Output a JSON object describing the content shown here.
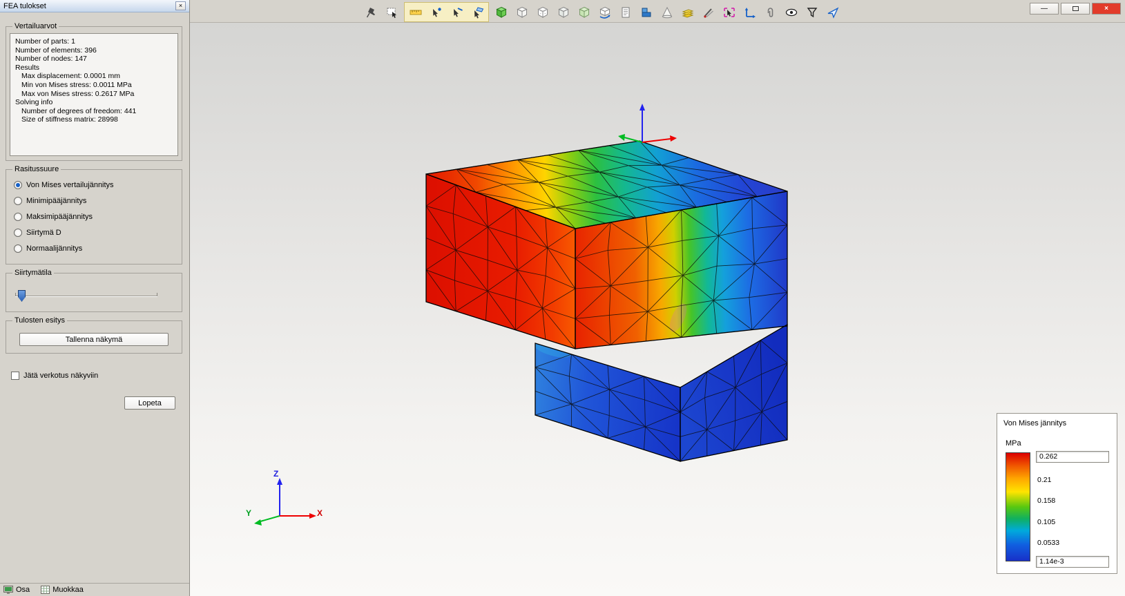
{
  "colors": {
    "accent": "#1560c8",
    "stress_scale": [
      "#dc0000",
      "#f05800",
      "#ffa800",
      "#ffe400",
      "#58c810",
      "#00aadc",
      "#1830c8"
    ]
  },
  "window": {
    "minimize_label": "—",
    "close_label": "×"
  },
  "toolbar": {
    "icons": [
      "pin",
      "select-region",
      "ruler",
      "snap-point",
      "snap-edge",
      "snap-face",
      "shaded-cube",
      "wire-cube",
      "wire-cube-2",
      "wire-cube-3",
      "ghost-cube",
      "rotate-cube",
      "report",
      "extrude-steps",
      "cone",
      "layers",
      "cutter",
      "zoom-region",
      "move-axes",
      "attach",
      "eye",
      "filter",
      "send-plane"
    ]
  },
  "panel": {
    "title": "FEA tulokset",
    "close_label": "×",
    "info_group": {
      "label": "Vertailuarvot",
      "lines": [
        {
          "text": "Number of parts: 1",
          "indent": 0
        },
        {
          "text": "Number of elements: 396",
          "indent": 0
        },
        {
          "text": "Number of nodes: 147",
          "indent": 0
        },
        {
          "text": "Results",
          "indent": 0
        },
        {
          "text": "Max displacement: 0.0001 mm",
          "indent": 1
        },
        {
          "text": "Min von Mises stress: 0.0011 MPa",
          "indent": 1
        },
        {
          "text": "Max von Mises stress: 0.2617 MPa",
          "indent": 1
        },
        {
          "text": "Solving info",
          "indent": 0
        },
        {
          "text": "Number of degrees of freedom: 441",
          "indent": 1
        },
        {
          "text": "Size of stiffness matrix: 28998",
          "indent": 1
        }
      ]
    },
    "quantity_group": {
      "label": "Rasitussuure",
      "options": [
        {
          "label": "Von Mises vertailujännitys",
          "selected": true
        },
        {
          "label": "Minimipääjännitys",
          "selected": false
        },
        {
          "label": "Maksimipääjännitys",
          "selected": false
        },
        {
          "label": "Siirtymä D",
          "selected": false
        },
        {
          "label": "Normaalijännitys",
          "selected": false
        }
      ]
    },
    "displacement_group": {
      "label": "Siirtymätila"
    },
    "results_group": {
      "label": "Tulosten esitys",
      "save_view_label": "Tallenna näkymä"
    },
    "mesh_checkbox": {
      "label": "Jätä verkotus näkyviin",
      "checked": false
    },
    "quit_label": "Lopeta",
    "taskbar": [
      {
        "label": "Osa"
      },
      {
        "label": "Muokkaa"
      }
    ]
  },
  "viewport": {
    "axes": {
      "x": "X",
      "y": "Y",
      "z": "Z"
    },
    "legend": {
      "title": "Von Mises jännitys",
      "unit": "MPa",
      "values": [
        "0.262",
        "0.21",
        "0.158",
        "0.105",
        "0.0533",
        "1.14e-3"
      ]
    }
  }
}
